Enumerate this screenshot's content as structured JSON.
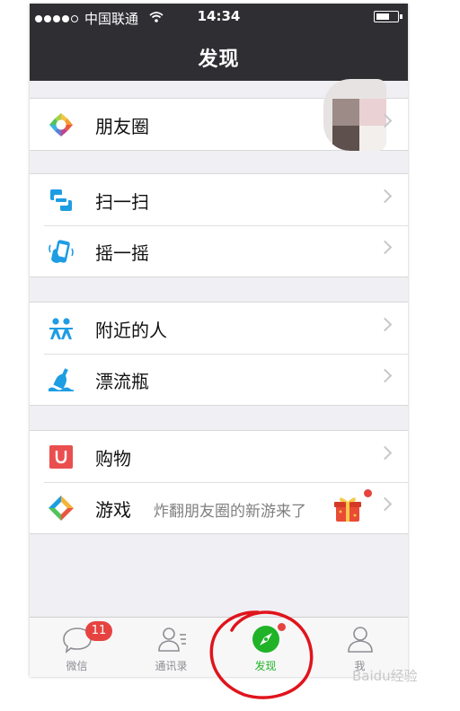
{
  "status_bar": {
    "carrier": "中国联通",
    "time": "14:34"
  },
  "nav": {
    "title": "发现"
  },
  "menu": {
    "moments": "朋友圈",
    "scan": "扫一扫",
    "shake": "摇一摇",
    "nearby": "附近的人",
    "bottle": "漂流瓶",
    "shopping": "购物",
    "games": "游戏",
    "games_subtext": "炸翻朋友圈的新游来了"
  },
  "tabs": {
    "chats": {
      "label": "微信",
      "badge": "11"
    },
    "contacts": {
      "label": "通讯录"
    },
    "discover": {
      "label": "发现"
    },
    "me": {
      "label": "我"
    }
  },
  "watermark": "Baidu经验",
  "colors": {
    "header": "#2f2e33",
    "active_tab": "#20b327",
    "badge": "#e64340",
    "annotation_circle": "#e0141c"
  }
}
